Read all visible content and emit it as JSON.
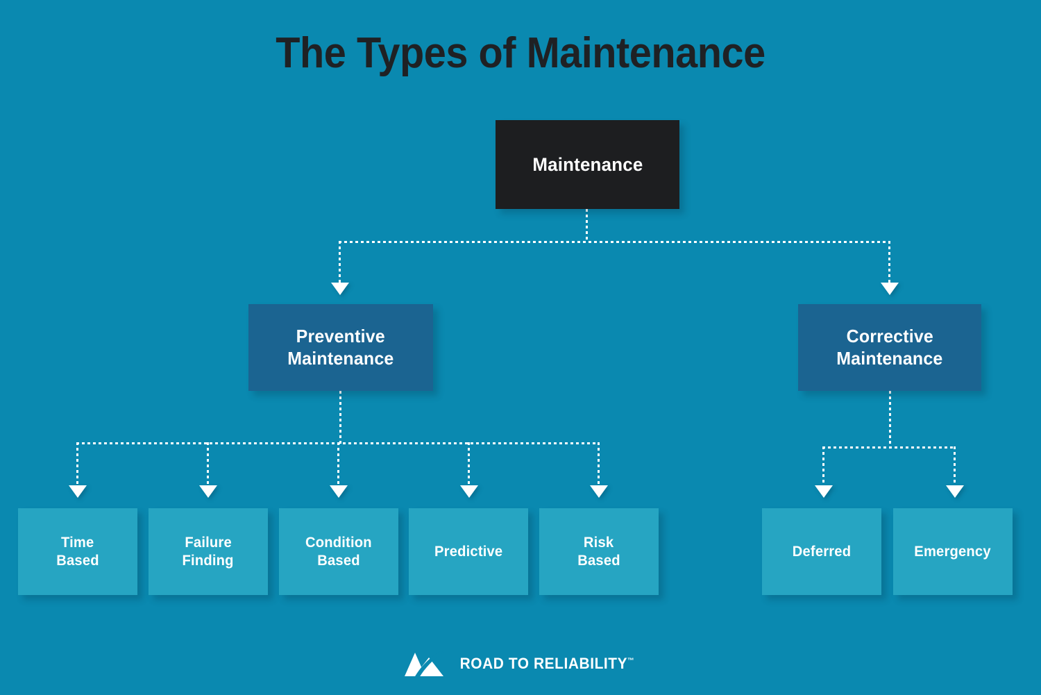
{
  "title": "The Types of Maintenance",
  "colors": {
    "background": "#0a89b0",
    "root_box": "#1d1e20",
    "mid_box": "#1b6491",
    "leaf_box": "#26a5c2",
    "text": "#ffffff",
    "title_text": "#1f2124",
    "connector": "#ffffff"
  },
  "chart_data": {
    "type": "diagram",
    "subtype": "hierarchy-tree",
    "title": "The Types of Maintenance",
    "root": "Maintenance",
    "nodes": [
      {
        "id": "maintenance",
        "label": "Maintenance",
        "level": 0,
        "parent": null
      },
      {
        "id": "preventive",
        "label": "Preventive Maintenance",
        "level": 1,
        "parent": "maintenance"
      },
      {
        "id": "corrective",
        "label": "Corrective Maintenance",
        "level": 1,
        "parent": "maintenance"
      },
      {
        "id": "time-based",
        "label": "Time Based",
        "level": 2,
        "parent": "preventive"
      },
      {
        "id": "failure-finding",
        "label": "Failure Finding",
        "level": 2,
        "parent": "preventive"
      },
      {
        "id": "condition-based",
        "label": "Condition Based",
        "level": 2,
        "parent": "preventive"
      },
      {
        "id": "predictive",
        "label": "Predictive",
        "level": 2,
        "parent": "preventive"
      },
      {
        "id": "risk-based",
        "label": "Risk Based",
        "level": 2,
        "parent": "preventive"
      },
      {
        "id": "deferred",
        "label": "Deferred",
        "level": 2,
        "parent": "corrective"
      },
      {
        "id": "emergency",
        "label": "Emergency",
        "level": 2,
        "parent": "corrective"
      }
    ]
  },
  "root_node": {
    "label": "Maintenance"
  },
  "branches": {
    "preventive": {
      "line1": "Preventive",
      "line2": "Maintenance"
    },
    "corrective": {
      "line1": "Corrective",
      "line2": "Maintenance"
    }
  },
  "leaves": {
    "preventive": [
      {
        "line1": "Time",
        "line2": "Based"
      },
      {
        "line1": "Failure",
        "line2": "Finding"
      },
      {
        "line1": "Condition",
        "line2": "Based"
      },
      {
        "line1": "Predictive",
        "line2": ""
      },
      {
        "line1": "Risk",
        "line2": "Based"
      }
    ],
    "corrective": [
      {
        "line1": "Deferred",
        "line2": ""
      },
      {
        "line1": "Emergency",
        "line2": ""
      }
    ]
  },
  "footer": {
    "brand": "ROAD TO RELIABILITY",
    "trademark": "™",
    "logo_icon": "mountain-swoosh-icon"
  }
}
